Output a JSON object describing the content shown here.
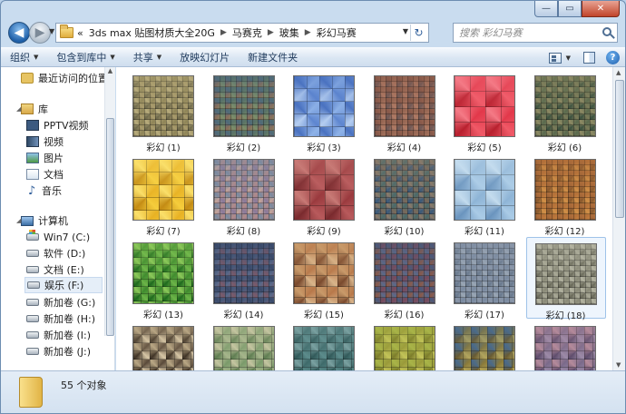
{
  "window": {
    "caption_buttons": [
      "—",
      "▭",
      "✕"
    ]
  },
  "address": {
    "crumbs": [
      "3ds max 贴图材质大全20G",
      "马赛克",
      "玻集",
      "彩幻马赛"
    ],
    "prefix": "«"
  },
  "search": {
    "placeholder": "搜索 彩幻马赛"
  },
  "toolbar": {
    "items": [
      {
        "label": "组织",
        "arrow": true
      },
      {
        "label": "包含到库中",
        "arrow": true
      },
      {
        "label": "共享",
        "arrow": true
      },
      {
        "label": "放映幻灯片",
        "arrow": false
      },
      {
        "label": "新建文件夹",
        "arrow": false
      }
    ],
    "help_glyph": "?"
  },
  "nav": {
    "recent": "最近访问的位置",
    "library": "库",
    "lib_items": [
      "PPTV视频",
      "视频",
      "图片",
      "文档",
      "音乐"
    ],
    "computer": "计算机",
    "drives": [
      "Win7 (C:)",
      "软件 (D:)",
      "文档 (E:)",
      "娱乐 (F:)",
      "新加卷 (G:)",
      "新加卷 (H:)",
      "新加卷 (I:)",
      "新加卷 (J:)"
    ]
  },
  "files": [
    {
      "label": "彩幻 (1)",
      "colors": [
        "#8f8558",
        "#a99b6c",
        "#6f6a4c",
        "#b8ac7d"
      ],
      "tile": 6
    },
    {
      "label": "彩幻 (2)",
      "colors": [
        "#5b7466",
        "#7c8e6a",
        "#8a6e5b",
        "#4f6a7b"
      ],
      "tile": 6
    },
    {
      "label": "彩幻 (3)",
      "colors": [
        "#8fb3e8",
        "#5e86d0",
        "#b4cdf0",
        "#4a72c0"
      ],
      "tile": 14
    },
    {
      "label": "彩幻 (4)",
      "colors": [
        "#9a6a56",
        "#b07a64",
        "#6f5a58",
        "#8a5a4a"
      ],
      "tile": 6
    },
    {
      "label": "彩幻 (5)",
      "colors": [
        "#e2384a",
        "#f05a68",
        "#b8202e",
        "#f47a86"
      ],
      "tile": 17
    },
    {
      "label": "彩幻 (6)",
      "colors": [
        "#5a6a4e",
        "#7a7a58",
        "#3c5240",
        "#8e8a64"
      ],
      "tile": 6
    },
    {
      "label": "彩幻 (7)",
      "colors": [
        "#e8b224",
        "#f5cd3c",
        "#c48c14",
        "#fadf6a"
      ],
      "tile": 14
    },
    {
      "label": "彩幻 (8)",
      "colors": [
        "#b08a8a",
        "#8a7a9a",
        "#c4a49a",
        "#7a8aa0"
      ],
      "tile": 6
    },
    {
      "label": "彩幻 (9)",
      "colors": [
        "#9a3a3e",
        "#b85a5c",
        "#7a2a2e",
        "#c87a76"
      ],
      "tile": 17
    },
    {
      "label": "彩幻 (10)",
      "colors": [
        "#4a6a6a",
        "#7a6a5a",
        "#3a5a7a",
        "#8a7a6a"
      ],
      "tile": 6
    },
    {
      "label": "彩幻 (11)",
      "colors": [
        "#8eb4d6",
        "#aacbe6",
        "#6a94be",
        "#c4dcee"
      ],
      "tile": 17
    },
    {
      "label": "彩幻 (12)",
      "colors": [
        "#b8743a",
        "#d09048",
        "#8a5a2e",
        "#a86a3a"
      ],
      "tile": 6
    },
    {
      "label": "彩幻 (13)",
      "colors": [
        "#3e8a2e",
        "#6cb448",
        "#1f6a1e",
        "#8cc85a"
      ],
      "tile": 8
    },
    {
      "label": "彩幻 (14)",
      "colors": [
        "#4a5a7a",
        "#7a5a6a",
        "#5a6a8a",
        "#3a4a6a"
      ],
      "tile": 6
    },
    {
      "label": "彩幻 (15)",
      "colors": [
        "#b8784a",
        "#d8b48a",
        "#7a4a2e",
        "#c89a6a"
      ],
      "tile": 12
    },
    {
      "label": "彩幻 (16)",
      "colors": [
        "#7a4a5a",
        "#5a6a8a",
        "#8a5a4a",
        "#4a5a7a"
      ],
      "tile": 6
    },
    {
      "label": "彩幻 (17)",
      "colors": [
        "#7a8aa0",
        "#9aa6b4",
        "#6a7a8e",
        "#8a96a8"
      ],
      "tile": 6
    },
    {
      "label": "彩幻 (18)",
      "colors": [
        "#8a8a78",
        "#a8a896",
        "#6a6a5a",
        "#b4b4a2"
      ],
      "tile": 6,
      "selected": true
    },
    {
      "label": "",
      "colors": [
        "#5a4a3a",
        "#d8c8a8",
        "#3a2e22",
        "#b8a684"
      ],
      "tile": 9
    },
    {
      "label": "",
      "colors": [
        "#7a9a6a",
        "#a4b48a",
        "#5a7a4e",
        "#c4c4a0"
      ],
      "tile": 9
    },
    {
      "label": "",
      "colors": [
        "#3e6a6a",
        "#5a8a8a",
        "#2e5656",
        "#7aa0a0"
      ],
      "tile": 9
    },
    {
      "label": "",
      "colors": [
        "#9a9a3a",
        "#c4c45a",
        "#7a7a2a",
        "#a8b448"
      ],
      "tile": 9
    },
    {
      "label": "",
      "colors": [
        "#8a7a3a",
        "#b8a85a",
        "#6a5a2e",
        "#4a6a8a"
      ],
      "tile": 9
    },
    {
      "label": "",
      "colors": [
        "#7a6a8a",
        "#9a8aa8",
        "#5a4a6a",
        "#b48a9a"
      ],
      "tile": 9
    }
  ],
  "status": {
    "count": "55 个对象"
  }
}
